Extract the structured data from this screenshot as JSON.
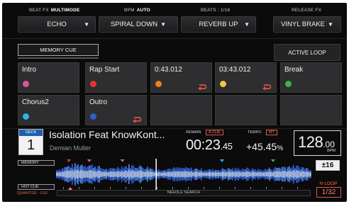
{
  "fx": {
    "beat_fx_label": "BEAT FX",
    "beat_fx_mode": "MULTIMODE",
    "bpm_label": "BPM",
    "bpm_mode": "AUTO",
    "beats_label": "BEATS : 1/16",
    "release_fx_label": "RELEASE FX",
    "buttons": [
      {
        "label": "ECHO",
        "arrow": "▼"
      },
      {
        "label": "SPIRAL DOWN",
        "arrow": "▼"
      },
      {
        "label": "REVERB UP",
        "arrow": "▼"
      },
      {
        "label": "VINYL BRAKE",
        "arrow": "▼"
      }
    ]
  },
  "memory_cue_label": "MEMORY CUE",
  "active_loop_label": "ACTIVE LOOP",
  "hot_cues": [
    {
      "label": "Intro",
      "color": "#e0529b",
      "loop": false
    },
    {
      "label": "Rap Start",
      "color": "#e8322e",
      "loop": false
    },
    {
      "label": "0:43.012",
      "color": "#ef7f1a",
      "loop": true
    },
    {
      "label": "03:43.012",
      "color": "#f0c93a",
      "loop": true
    },
    {
      "label": "Break",
      "color": "#3bb34a",
      "loop": false
    },
    {
      "label": "Chorus2",
      "color": "#29b5e6",
      "loop": false
    },
    {
      "label": "Outro",
      "color": "#2d5fd0",
      "loop": true
    },
    {
      "label": "",
      "color": "",
      "loop": false
    },
    {
      "label": "",
      "color": "",
      "loop": false
    },
    {
      "label": "",
      "color": "",
      "loop": false
    }
  ],
  "deck": {
    "tag": "DECK",
    "number": "1",
    "title": "Isolation Feat KnowKont...",
    "artist": "Demian Muller"
  },
  "time": {
    "remain_label": "REMAIN",
    "cue_tag": "A.CUE",
    "main": "00:23",
    "ms": ".45"
  },
  "tempo": {
    "label": "TEMPO",
    "tag": "MT",
    "value": "+45.45",
    "unit": "%"
  },
  "bpm": {
    "int": "128",
    "dec": ".00",
    "unit": "BPM"
  },
  "waveform": {
    "memory_tag": "MEMORY",
    "hot_cue_tag": "HOT CUE",
    "quantize": "QUANTIZE : 1/16",
    "needle_search": "NEEDLE SEARCH",
    "tempo_range": "±16",
    "loop_label": "LOOP",
    "loop_value": "1/32",
    "playhead_fraction": 0.39,
    "cue_markers": [
      {
        "pos": 0.05,
        "color": "#e8322e"
      },
      {
        "pos": 0.13,
        "color": "#e0529b"
      },
      {
        "pos": 0.26,
        "color": "#e0529b"
      },
      {
        "pos": 0.65,
        "color": "#29b5e6"
      },
      {
        "pos": 0.85,
        "color": "#3bb34a"
      }
    ]
  }
}
